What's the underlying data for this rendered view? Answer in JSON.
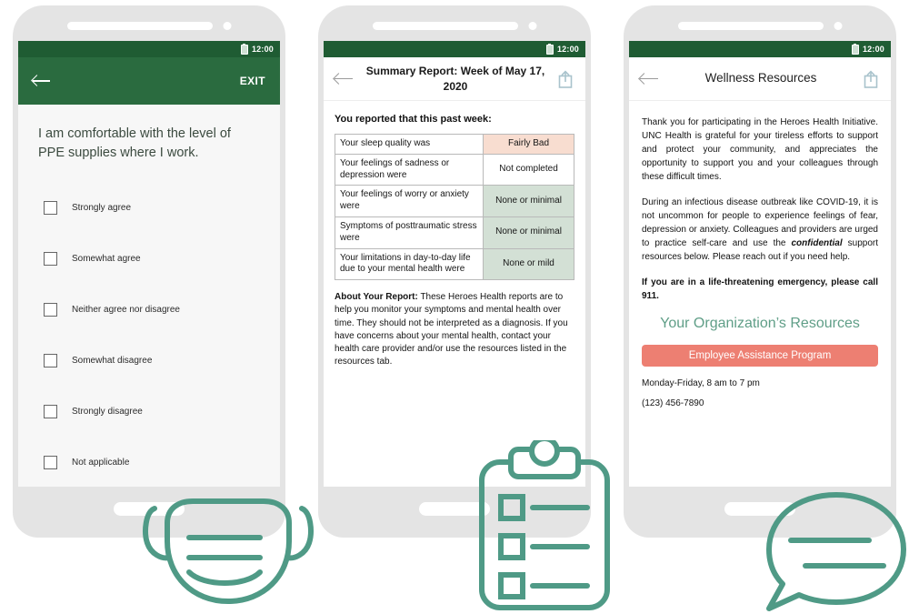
{
  "phones": [
    {
      "id": "survey",
      "status": {
        "time": "12:00",
        "battery_icon": "battery-icon"
      },
      "appbar": {
        "back_icon": "back-arrow-icon",
        "exit_label": "EXIT"
      },
      "question": "I am comfortable with the level of PPE supplies where I work.",
      "options": [
        "Strongly agree",
        "Somewhat agree",
        "Neither agree nor disagree",
        "Somewhat disagree",
        "Strongly disagree",
        "Not applicable"
      ]
    },
    {
      "id": "summary-report",
      "status": {
        "time": "12:00",
        "battery_icon": "battery-icon"
      },
      "appbar": {
        "back_icon": "back-arrow-icon",
        "title": "Summary Report: Week of May 17, 2020",
        "share_icon": "share-icon"
      },
      "heading": "You reported that this past week:",
      "rows": [
        {
          "label": "Your sleep quality was",
          "value": "Fairly Bad",
          "tone": "peach"
        },
        {
          "label": "Your feelings of sadness or depression were",
          "value": "Not completed",
          "tone": "white"
        },
        {
          "label": "Your feelings of worry or anxiety were",
          "value": "None or minimal",
          "tone": "sage"
        },
        {
          "label": "Symptoms of posttraumatic stress were",
          "value": "None or minimal",
          "tone": "sage"
        },
        {
          "label": "Your limitations in day-to-day life due to your mental health were",
          "value": "None or mild",
          "tone": "sage"
        }
      ],
      "about_label": "About Your Report:",
      "about_text": " These Heroes Health reports are to help you monitor your symptoms and mental health over time. They should not be interpreted as a diagnosis. If you have concerns about your mental health, contact your health care provider and/or use the resources listed in the resources tab."
    },
    {
      "id": "wellness-resources",
      "status": {
        "time": "12:00",
        "battery_icon": "battery-icon"
      },
      "appbar": {
        "back_icon": "back-arrow-icon",
        "title": "Wellness Resources",
        "share_icon": "share-icon"
      },
      "paragraph_1": "Thank you for participating in the Heroes Health Initiative. UNC Health is grateful for your tireless efforts to support and protect your community, and appreciates the opportunity to support you and your colleagues through these difficult times.",
      "paragraph_2_a": "During an infectious disease outbreak like COVID-19, it is not uncommon for people to experience feelings of fear, depression or anxiety. Colleagues and providers are urged to practice self-care and use the ",
      "paragraph_2_em": "confidential",
      "paragraph_2_b": " support resources below. Please reach out if you need help.",
      "emergency_text": "If you are in a life-threatening emergency, please call 911.",
      "org_heading": "Your Organization’s Resources",
      "eap_button": "Employee Assistance Program",
      "hours": "Monday-Friday, 8 am to 7 pm",
      "phone": "(123) 456-7890"
    }
  ],
  "decorations": [
    {
      "name": "face-mask-icon"
    },
    {
      "name": "clipboard-checklist-icon"
    },
    {
      "name": "speech-bubble-icon"
    }
  ],
  "colors": {
    "status_bar_green": "#1f5c33",
    "appbar_green": "#2a6b3f",
    "phone_body_gray": "#e4e4e4",
    "accent_teal": "#5f9e87",
    "eap_coral": "#ed7f72",
    "cell_peach": "#f8ddd0",
    "cell_sage": "#d3e0d5"
  }
}
